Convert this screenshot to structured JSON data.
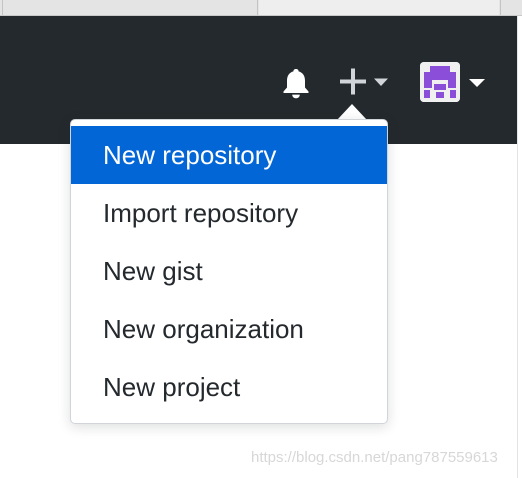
{
  "header": {
    "background": "#24292e",
    "notification_icon": "bell-icon",
    "create_icon": "plus-icon",
    "caret_icon": "triangle-down-icon",
    "avatar_icon": "pixel-avatar-icon",
    "avatar_color": "#8a4ed8"
  },
  "dropdown": {
    "accent": "#0366d6",
    "items": [
      {
        "label": "New repository",
        "active": true
      },
      {
        "label": "Import repository",
        "active": false
      },
      {
        "label": "New gist",
        "active": false
      },
      {
        "label": "New organization",
        "active": false
      },
      {
        "label": "New project",
        "active": false
      }
    ]
  },
  "watermark": {
    "text": "https://blog.csdn.net/pang787559613"
  }
}
